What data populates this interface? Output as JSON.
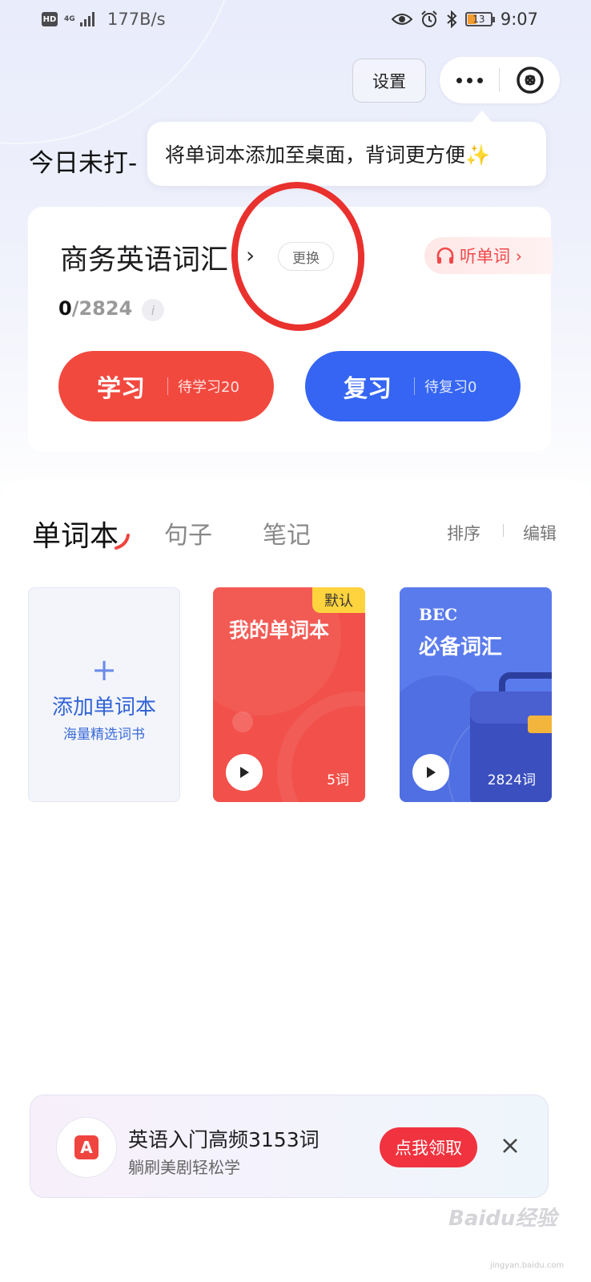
{
  "status_bar": {
    "hd_badge": "HD",
    "network_type": "4G",
    "net_speed": "177B/s",
    "battery_level": "13",
    "time": "9:07",
    "icons": [
      "eye-comfort-icon",
      "alarm-icon",
      "bluetooth-icon",
      "battery-icon"
    ]
  },
  "header": {
    "settings_label": "设置",
    "tooltip_text": "将单词本添加至桌面，背词更方便✨",
    "today_title": "今日未打-"
  },
  "word_card": {
    "book_name": "商务英语词汇",
    "chevron": "›",
    "change_label": "更换",
    "listen_label": "听单词 ›",
    "progress_done": "0",
    "progress_total": "/2824",
    "info_glyph": "i",
    "study": {
      "label": "学习",
      "sub": "待学习20"
    },
    "review": {
      "label": "复习",
      "sub": "待复习0"
    },
    "colors": {
      "study": "#f2493f",
      "review": "#3565f2"
    }
  },
  "tabs": {
    "wordbook": "单词本",
    "sentence": "句子",
    "notes": "笔记",
    "sort": "排序",
    "edit": "编辑"
  },
  "books": {
    "add": {
      "plus": "+",
      "title": "添加单词本",
      "subtitle": "海量精选词书"
    },
    "mine": {
      "badge": "默认",
      "name": "我的单词本",
      "count": "5词"
    },
    "bec": {
      "title": "BEC",
      "subtitle": "必备词汇",
      "count": "2824词"
    }
  },
  "promo": {
    "icon_letter": "A",
    "title": "英语入门高频3153词",
    "subtitle": "躺刷美剧轻松学",
    "claim_label": "点我领取"
  },
  "watermark": {
    "brand": "Baidu经验",
    "url": "jingyan.baidu.com"
  }
}
